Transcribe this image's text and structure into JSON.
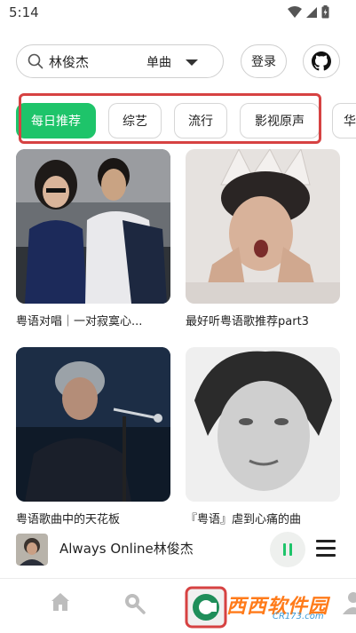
{
  "status_bar": {
    "time": "5:14"
  },
  "search": {
    "query": "林俊杰",
    "type": "单曲"
  },
  "header": {
    "login_label": "登录"
  },
  "tags": [
    "每日推荐",
    "综艺",
    "流行",
    "影视原声",
    "华"
  ],
  "active_tag_index": 0,
  "playlists": [
    {
      "title": "粤语对唱｜一对寂寞心..."
    },
    {
      "title": "最好听粤语歌推荐part3"
    },
    {
      "title": "粤语歌曲中的天花板"
    },
    {
      "title": "『粤语』虐到心痛的曲"
    }
  ],
  "player": {
    "title": "Always Online林俊杰"
  },
  "watermark": {
    "brand": "西西软件园",
    "url": "CR173.com"
  },
  "colors": {
    "accent": "#1ec46a",
    "highlight": "#d64242"
  }
}
